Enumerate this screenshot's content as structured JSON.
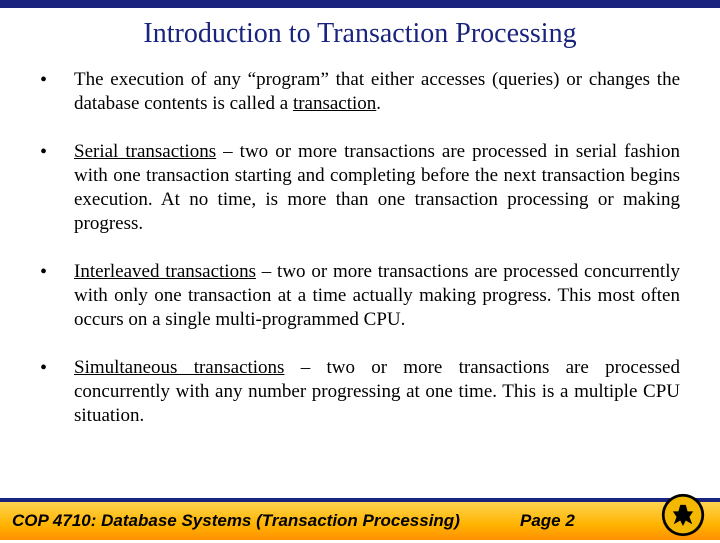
{
  "title": "Introduction to Transaction Processing",
  "bullets": {
    "b0": {
      "pre": "The execution of any “program” that either accesses (queries) or changes the database contents is called a ",
      "term": "transaction",
      "post": "."
    },
    "b1": {
      "term": "Serial transactions",
      "rest": " – two or more transactions are processed in serial fashion with one transaction starting and completing before the next transaction begins execution.  At no time, is more than one transaction processing or making progress."
    },
    "b2": {
      "term": "Interleaved transactions",
      "rest": " – two or more transactions are processed concurrently with only one transaction at a time actually making progress.  This most often occurs on a single multi-programmed CPU."
    },
    "b3": {
      "term": "Simultaneous transactions",
      "rest": " – two or more transactions are processed concurrently with any number progressing at one time.  This is a multiple CPU situation."
    }
  },
  "footer": {
    "course": "COP 4710: Database Systems  (Transaction Processing)",
    "page": "Page 2"
  }
}
